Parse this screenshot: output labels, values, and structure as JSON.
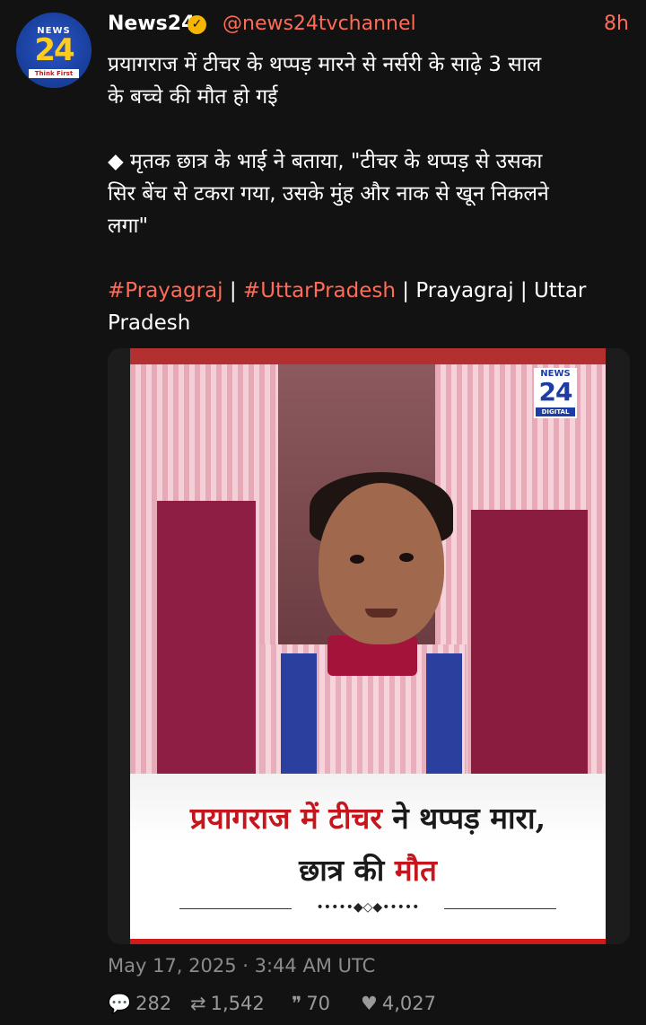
{
  "author": {
    "name": "News24",
    "handle": "@news24tvchannel",
    "time": "8h",
    "avatar_text_top": "NEWS",
    "avatar_text_num": "24",
    "avatar_tagline": "Think First"
  },
  "tweet": {
    "line1": "प्रयागराज में टीचर के थप्पड़ मारने से नर्सरी के साढ़े 3 साल",
    "line2": "के बच्चे की मौत हो गई",
    "line3": "◆ मृतक छात्र के भाई ने बताया, \"टीचर के थप्पड़ से उसका",
    "line4": "सिर बेंच से टकरा गया, उसके मुंह और नाक से खून निकलने",
    "line5": "लगा\"",
    "hashtag1": "#Prayagraj",
    "sep1": " | ",
    "hashtag2": "#UttarPradesh",
    "rest1": " | Prayagraj | Uttar",
    "rest2": "Pradesh"
  },
  "media": {
    "logo_top": "NEWS",
    "logo_num": "24",
    "logo_bottom": "DIGITAL",
    "headline_line1_red": "प्रयागराज में टीचर",
    "headline_line1_black": " ने थप्पड़ मारा,",
    "headline_line2_black": "छात्र की ",
    "headline_line2_red": "मौत",
    "ornament": "•••••◆◇◆•••••"
  },
  "meta": {
    "date": "May 17, 2025 · 3:44 AM UTC"
  },
  "stats": {
    "replies": "282",
    "retweets": "1,542",
    "quotes": "70",
    "likes": "4,027"
  },
  "colors": {
    "accent": "#ff6b57",
    "background": "#121212",
    "verified": "#f7b500"
  }
}
